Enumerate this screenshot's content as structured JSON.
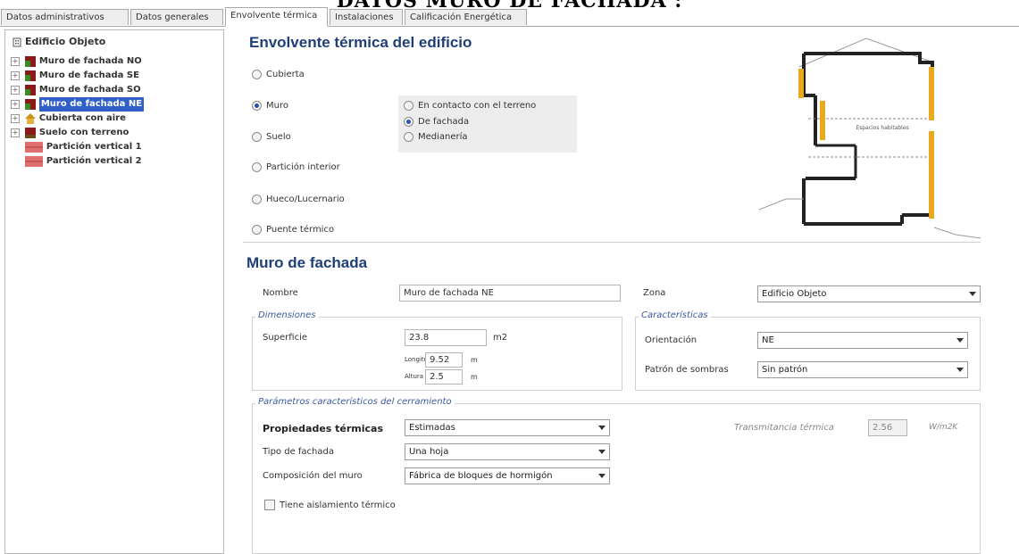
{
  "banner": "DATOS MURO DE FACHADA :",
  "tabs": [
    "Datos administrativos",
    "Datos generales",
    "Envolvente térmica",
    "Instalaciones",
    "Calificación Energética"
  ],
  "tree": {
    "root": "Edificio Objeto",
    "items": [
      {
        "label": "Muro de fachada NO"
      },
      {
        "label": "Muro de fachada SE"
      },
      {
        "label": "Muro de fachada SO"
      },
      {
        "label": "Muro de fachada NE"
      },
      {
        "label": "Cubierta con aire"
      },
      {
        "label": "Suelo con terreno"
      },
      {
        "label": "Partición vertical 1"
      },
      {
        "label": "Partición vertical 2"
      }
    ]
  },
  "envolvente": {
    "title": "Envolvente térmica del edificio",
    "options": [
      "Cubierta",
      "Muro",
      "Suelo",
      "Partición interior",
      "Hueco/Lucernario",
      "Puente térmico"
    ],
    "selected": "Muro",
    "muro_options": [
      "En contacto con el terreno",
      "De fachada",
      "Medianería"
    ],
    "muro_selected": "De fachada",
    "diagram_label": "Espacios habitables"
  },
  "muro": {
    "title": "Muro de fachada",
    "nombre_label": "Nombre",
    "nombre_value": "Muro de fachada NE",
    "zona_label": "Zona",
    "zona_value": "Edificio Objeto",
    "dimensiones_title": "Dimensiones",
    "superficie_label": "Superficie",
    "superficie_value": "23.8",
    "superficie_unit": "m2",
    "longitud_label": "Longitud",
    "longitud_value": "9.52",
    "altura_label": "Altura",
    "altura_value": "2.5",
    "len_unit": "m",
    "caracteristicas_title": "Características",
    "orientacion_label": "Orientación",
    "orientacion_value": "NE",
    "patron_label": "Patrón de sombras",
    "patron_value": "Sin patrón",
    "parametros_title": "Parámetros característicos del cerramiento",
    "propiedades_label": "Propiedades térmicas",
    "propiedades_value": "Estimadas",
    "tipo_label": "Tipo de fachada",
    "tipo_value": "Una hoja",
    "composicion_label": "Composición del muro",
    "composicion_value": "Fábrica de bloques de hormigón",
    "transmitancia_label": "Transmitancia térmica",
    "transmitancia_value": "2.56",
    "transmitancia_unit": "W/m2K",
    "aislamiento_label": "Tiene aislamiento térmico"
  },
  "colors": {
    "accent": "#1f3f7a",
    "selection": "#2f5fc9",
    "insulation": "#e8a91c"
  }
}
